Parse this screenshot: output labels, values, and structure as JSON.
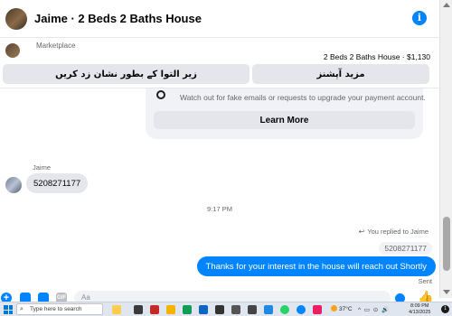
{
  "header": {
    "title": "Jaime · 2 Beds 2 Baths House",
    "info_glyph": "i"
  },
  "marketplace": {
    "label": "Marketplace",
    "listing": "2 Beds 2 Baths House · $1,130",
    "buttons": [
      {
        "label": "زیر التوا کے بطور نشان زد کریں"
      },
      {
        "label": "مزید آپشنز"
      }
    ]
  },
  "security_card": {
    "warning": "Watch out for fake emails or requests to upgrade your payment account.",
    "learn_more": "Learn More"
  },
  "messages": {
    "sender_name": "Jaime",
    "incoming_text": "5208271177",
    "timestamp": "9:17 PM",
    "replied_label": "You replied to Jaime",
    "quoted_text": "5208271177",
    "outgoing_text": "Thanks for your interest in the house will reach out Shortly",
    "sent_status": "Sent"
  },
  "composer": {
    "input_text": "Aa",
    "plus_glyph": "+",
    "gif_label": "GIF",
    "like_glyph": "👍"
  },
  "taskbar": {
    "search_placeholder": "Type here to search",
    "weather": "37°C",
    "tray": "^ ▭ ⊙ 🔊",
    "time": "8:09 PM",
    "date": "4/13/2025",
    "notification_count": "1"
  },
  "colors": {
    "accent": "#0084ff",
    "bubble_in": "#e4e6eb",
    "card_bg": "#f0f2f5"
  }
}
